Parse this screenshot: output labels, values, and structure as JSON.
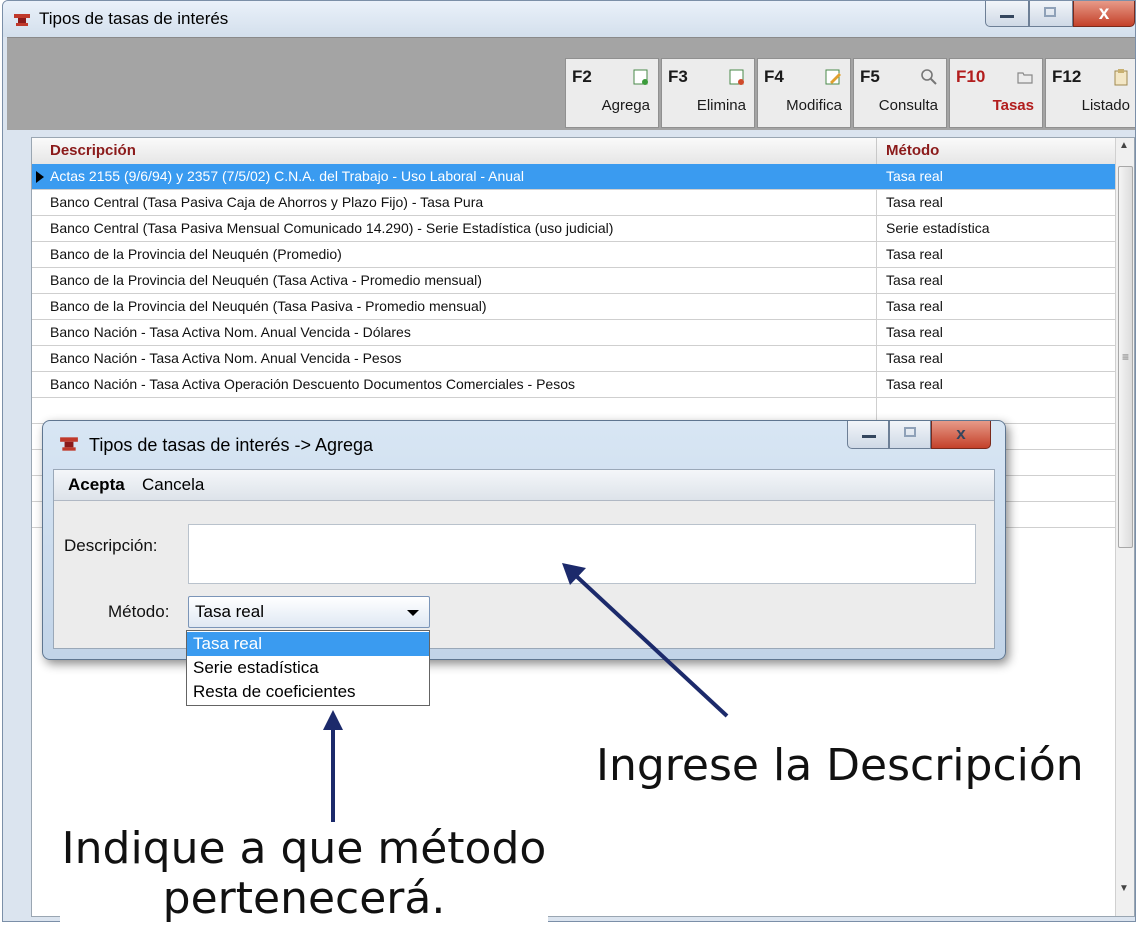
{
  "window": {
    "title": "Tipos de tasas de interés",
    "controls": {
      "minimize": "minimize",
      "maximize": "maximize",
      "close": "x"
    }
  },
  "toolbar": {
    "buttons": [
      {
        "key": "F2",
        "label": "Agrega",
        "icon": "add-doc-icon"
      },
      {
        "key": "F3",
        "label": "Elimina",
        "icon": "delete-doc-icon"
      },
      {
        "key": "F4",
        "label": "Modifica",
        "icon": "edit-doc-icon"
      },
      {
        "key": "F5",
        "label": "Consulta",
        "icon": "search-icon"
      },
      {
        "key": "F10",
        "label": "Tasas",
        "icon": "folder-icon",
        "active": true
      },
      {
        "key": "F12",
        "label": "Listado",
        "icon": "clipboard-icon"
      }
    ]
  },
  "grid": {
    "columns": [
      "Descripción",
      "Método"
    ],
    "rows": [
      {
        "descripcion": "Actas 2155 (9/6/94) y 2357 (7/5/02) C.N.A. del Trabajo  - Uso Laboral - Anual",
        "metodo": "Tasa real",
        "selected": true
      },
      {
        "descripcion": "Banco Central (Tasa Pasiva Caja de Ahorros y Plazo Fijo) - Tasa Pura",
        "metodo": "Tasa real"
      },
      {
        "descripcion": "Banco Central (Tasa Pasiva Mensual Comunicado 14.290) - Serie Estadística (uso judicial)",
        "metodo": "Serie estadística"
      },
      {
        "descripcion": "Banco de la Provincia del Neuquén (Promedio)",
        "metodo": "Tasa real"
      },
      {
        "descripcion": "Banco de la Provincia del Neuquén (Tasa Activa - Promedio mensual)",
        "metodo": "Tasa real"
      },
      {
        "descripcion": "Banco de la Provincia del Neuquén (Tasa Pasiva - Promedio mensual)",
        "metodo": "Tasa real"
      },
      {
        "descripcion": "Banco Nación - Tasa Activa Nom. Anual Vencida - Dólares",
        "metodo": "Tasa real"
      },
      {
        "descripcion": "Banco Nación - Tasa Activa Nom. Anual Vencida - Pesos",
        "metodo": "Tasa real"
      },
      {
        "descripcion": "Banco Nación - Tasa Activa Operación Descuento Documentos Comerciales -  Pesos",
        "metodo": "Tasa real"
      }
    ]
  },
  "dialog": {
    "title": "Tipos de tasas de interés -> Agrega",
    "menu": {
      "accept": "Acepta",
      "cancel": "Cancela"
    },
    "description_label": "Descripción:",
    "description_value": "",
    "method_label": "Método:",
    "method_value": "Tasa real",
    "method_options": [
      "Tasa real",
      "Serie estadística",
      "Resta de coeficientes"
    ]
  },
  "annotations": {
    "description_hint": "Ingrese la Descripción",
    "method_hint_line1": "Indique a que método",
    "method_hint_line2": "pertenecerá."
  },
  "colors": {
    "selection": "#3a9bf0",
    "toolbar_bg": "#a4a4a4",
    "header_text": "#8b1a1a",
    "active_key": "#b21d1d",
    "arrow": "#1c2a6b"
  }
}
